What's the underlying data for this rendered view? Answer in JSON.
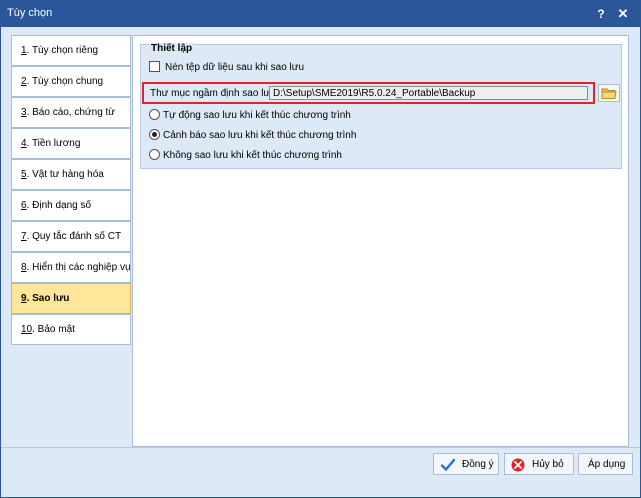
{
  "window": {
    "title": "Tùy chọn",
    "help_label": "?",
    "close_label": "✕"
  },
  "sidebar": {
    "items": [
      {
        "num": "1",
        "label": ". Tùy chọn riêng"
      },
      {
        "num": "2",
        "label": ". Tùy chọn chung"
      },
      {
        "num": "3",
        "label": ". Báo cáo, chứng từ"
      },
      {
        "num": "4",
        "label": ". Tiền lương"
      },
      {
        "num": "5",
        "label": ". Vật tư hàng hóa"
      },
      {
        "num": "6",
        "label": ". Định dạng số"
      },
      {
        "num": "7",
        "label": ". Quy tắc đánh số CT"
      },
      {
        "num": "8",
        "label": ". Hiển thị các nghiệp vụ"
      },
      {
        "num": "9",
        "label": ". Sao lưu"
      },
      {
        "num": "10",
        "label": ". Bảo mật"
      }
    ],
    "active_index": 8
  },
  "settings": {
    "group_title": "Thiết lập",
    "compress_label": "Nén tệp dữ liệu sau khi sao lưu",
    "compress_checked": false,
    "folder_label": "Thư mục ngầm định sao lưu",
    "folder_value": "D:\\Setup\\SME2019\\R5.0.24_Portable\\Backup",
    "options": [
      {
        "label": "Tự động sao lưu khi kết thúc chương trình",
        "selected": false
      },
      {
        "label": "Cảnh báo sao lưu khi kết thúc chương trình",
        "selected": true
      },
      {
        "label": "Không sao lưu khi kết thúc chương trình",
        "selected": false
      }
    ]
  },
  "footer": {
    "ok_label": "Đồng ý",
    "cancel_label": "Hủy bỏ",
    "apply_label": "Áp dụng"
  },
  "colors": {
    "title_bar": "#2b579a",
    "active_item": "#ffe699",
    "highlight_border": "#e2232a",
    "background": "#dde9f7"
  }
}
